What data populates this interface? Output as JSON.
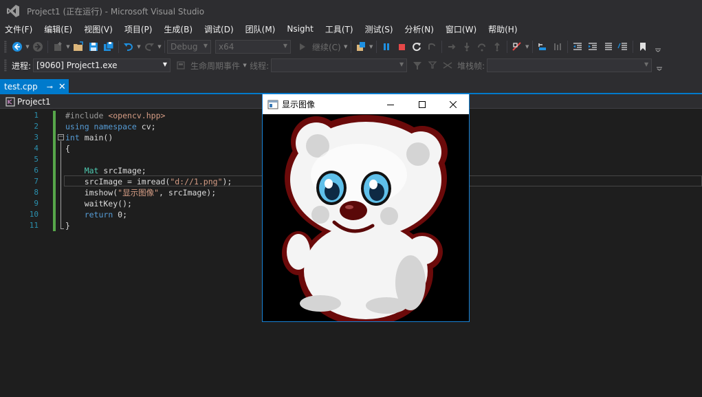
{
  "window": {
    "title": "Project1 (正在运行) - Microsoft Visual Studio"
  },
  "menu": [
    "文件(F)",
    "编辑(E)",
    "视图(V)",
    "项目(P)",
    "生成(B)",
    "调试(D)",
    "团队(M)",
    "Nsight",
    "工具(T)",
    "测试(S)",
    "分析(N)",
    "窗口(W)",
    "帮助(H)"
  ],
  "toolbar": {
    "configuration": "Debug",
    "platform": "x64",
    "continue_label": "继续(C)",
    "process_label": "进程:",
    "process_value": "[9060] Project1.exe",
    "lifecycle_label": "生命周期事件",
    "thread_label": "线程:",
    "stackframe_label": "堆栈帧:"
  },
  "editor": {
    "tab_label": "test.cpp",
    "nav_project": "Project1",
    "line_numbers": [
      "1",
      "2",
      "3",
      "4",
      "5",
      "6",
      "7",
      "8",
      "9",
      "10",
      "11"
    ]
  },
  "image_window": {
    "title": "显示图像"
  },
  "colors": {
    "accent": "#007acc",
    "background": "#2d2d30",
    "editor_bg": "#1e1e1e",
    "change_bar": "#57a64a",
    "line_number": "#2b91af"
  }
}
